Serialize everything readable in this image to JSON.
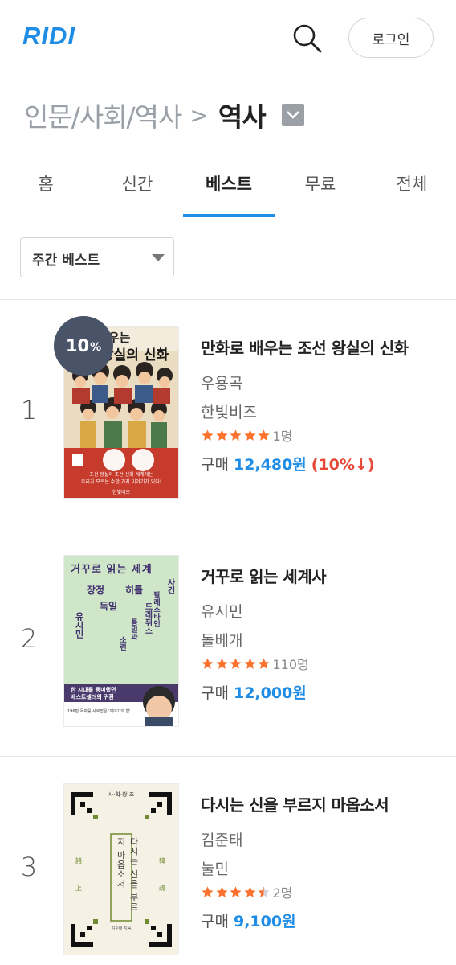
{
  "header": {
    "logo": "RIDI",
    "login_label": "로그인"
  },
  "breadcrumb": {
    "parent": "인문/사회/역사",
    "separator": ">",
    "current": "역사"
  },
  "tabs": [
    {
      "label": "홈",
      "active": false
    },
    {
      "label": "신간",
      "active": false
    },
    {
      "label": "베스트",
      "active": true
    },
    {
      "label": "무료",
      "active": false
    },
    {
      "label": "전체",
      "active": false
    }
  ],
  "filter": {
    "selected": "주간 베스트"
  },
  "books": [
    {
      "rank": "1",
      "title": "만화로 배우는 조선 왕실의 신화",
      "author": "우용곡",
      "publisher": "한빛비즈",
      "rating": 5,
      "rating_count": "1명",
      "price_label": "구매",
      "price": "12,480원",
      "discount": "(10%↓)",
      "badge_value": "10",
      "badge_unit": "%",
      "cover": {
        "top_text": "로 배우는",
        "title_text": "왕실의 신화",
        "bottom_line1": "조선 왕실이 조선 신화 세계에는",
        "bottom_line2": "우리가 모르는 수많 가지 이야기가 있다!",
        "publisher": "한빛비즈"
      }
    },
    {
      "rank": "2",
      "title": "거꾸로 읽는 세계사",
      "author": "유시민",
      "publisher": "돌베개",
      "rating": 5,
      "rating_count": "110명",
      "price_label": "구매",
      "price": "12,000원",
      "cover": {
        "top_text": "거꾸로 읽는 세계",
        "words": [
          "장정",
          "히틀",
          "독일",
          "드레퓌스",
          "사건",
          "팔레스타인",
          "통일과",
          "소련",
          "유시민"
        ],
        "band_line1": "한 시대를 풍미했던",
        "band_line2": "베스트셀러의 귀환",
        "footer": "196만 독자를 사로잡은 '이야기의 힘'"
      }
    },
    {
      "rank": "3",
      "title": "다시는 신을 부르지 마옵소서",
      "author": "김준태",
      "publisher": "눌민",
      "rating": 4.5,
      "rating_count": "2명",
      "price_label": "구매",
      "price": "9,100원",
      "cover": {
        "top_text": "사·학·왕·조",
        "vertical_title": "다시는 신을 부르지 마옵소서",
        "author": "김준태 지음",
        "side_left_top": "諸",
        "side_left_bottom": "上",
        "side_right_top": "韓",
        "side_right_bottom": "疏"
      }
    }
  ],
  "colors": {
    "accent": "#1f8ce6",
    "star": "#fa722e",
    "discount": "#e64938"
  }
}
